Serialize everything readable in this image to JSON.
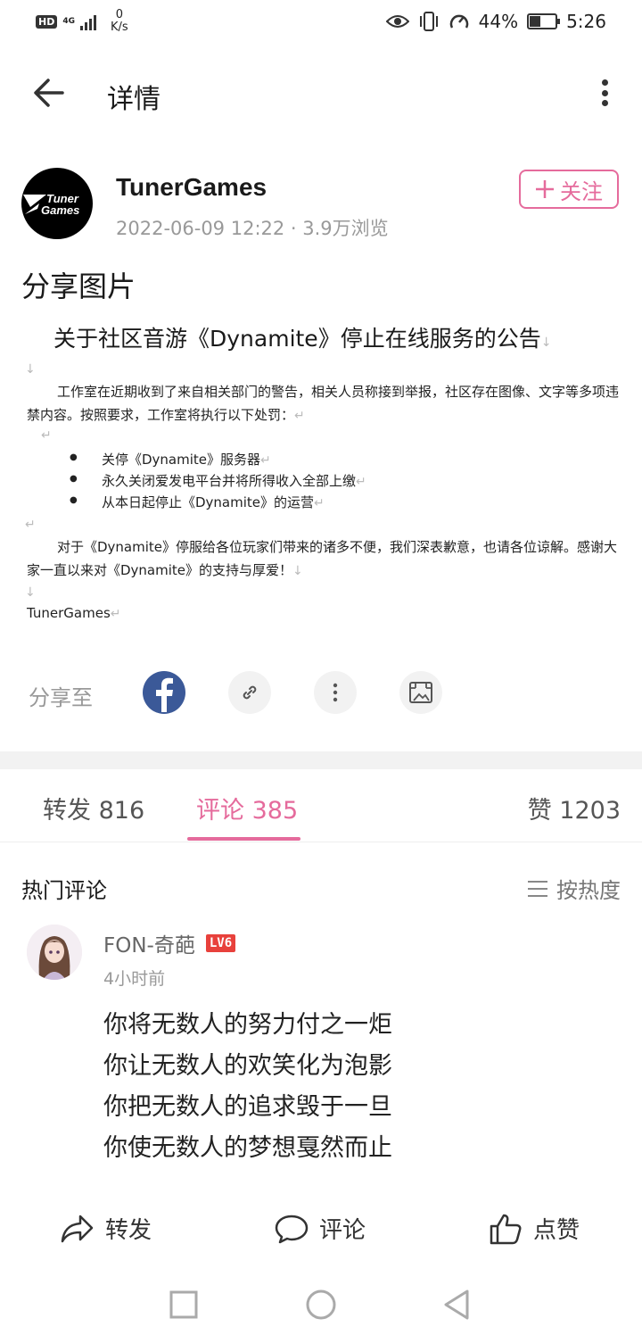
{
  "status_bar": {
    "hd": "HD",
    "network": "4G",
    "speed_value": "0",
    "speed_unit": "K/s",
    "battery": "44%",
    "battery_level": 0.44,
    "time": "5:26"
  },
  "app_bar": {
    "title": "详情"
  },
  "author": {
    "logo_line1": "Tuner",
    "logo_line2": "Games",
    "name": "TunerGames",
    "meta": "2022-06-09 12:22 · 3.9万浏览",
    "follow_label": "关注"
  },
  "post": {
    "title": "分享图片",
    "doc": {
      "heading": "关于社区音游《Dynamite》停止在线服务的公告",
      "para1": "工作室在近期收到了来自相关部门的警告，相关人员称接到举报，社区存在图像、文字等多项违禁内容。按照要求，工作室将执行以下处罚：",
      "bullets": [
        "关停《Dynamite》服务器",
        "永久关闭爱发电平台并将所得收入全部上缴",
        "从本日起停止《Dynamite》的运营"
      ],
      "para2": "对于《Dynamite》停服给各位玩家们带来的诸多不便，我们深表歉意，也请各位谅解。感谢大家一直以来对《Dynamite》的支持与厚爱！",
      "signature": "TunerGames"
    }
  },
  "share": {
    "label": "分享至"
  },
  "tabs": {
    "repost": "转发 816",
    "comments": "评论 385",
    "likes": "赞 1203"
  },
  "hot_comments": {
    "title": "热门评论",
    "sort_label": "按热度"
  },
  "comment": {
    "user": "FON-奇葩",
    "level": "LV6",
    "time": "4小时前",
    "lines": [
      "你将无数人的努力付之一炬",
      "你让无数人的欢笑化为泡影",
      "你把无数人的追求毁于一旦",
      "你使无数人的梦想戛然而止"
    ]
  },
  "actions": {
    "repost": "转发",
    "comment": "评论",
    "like": "点赞"
  },
  "colors": {
    "accent": "#e56b9c",
    "facebook": "#3b5998",
    "level_badge": "#e8413c"
  }
}
